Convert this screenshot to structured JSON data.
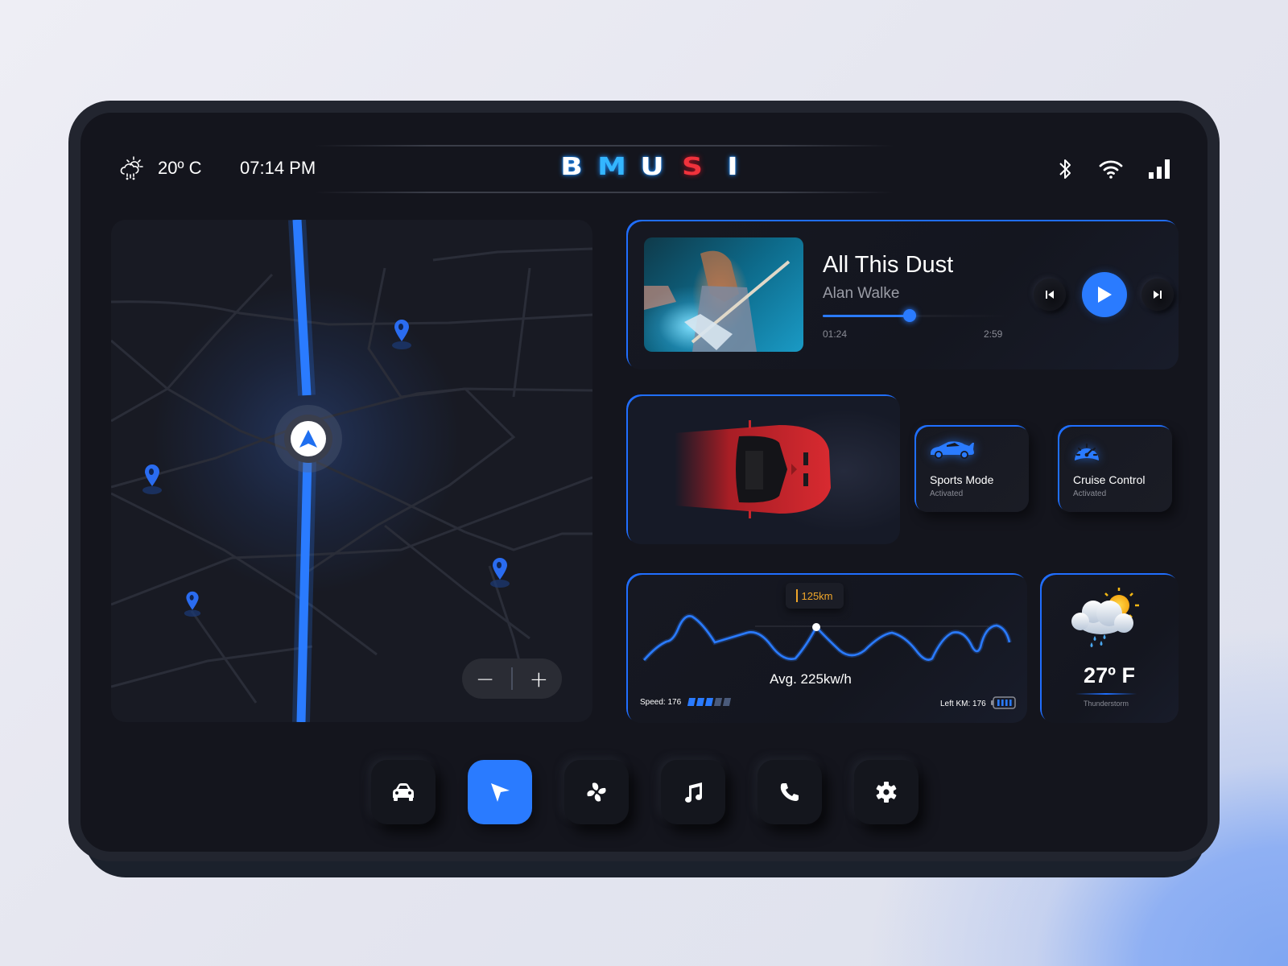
{
  "status_bar": {
    "weather_icon": "cloud-rain-sun-icon",
    "temperature": "20º C",
    "time": "07:14 PM",
    "logo_letters": [
      "B",
      "M",
      "U",
      "S",
      "I"
    ],
    "icons": [
      "bluetooth-icon",
      "wifi-icon",
      "signal-icon"
    ]
  },
  "map": {
    "zoom_out_label": "−",
    "zoom_in_label": "+",
    "pins": 4,
    "route_color": "#2a7bff"
  },
  "music": {
    "title": "All This Dust",
    "artist": "Alan Walke",
    "current_time": "01:24",
    "total_time": "2:59",
    "progress": 0.47,
    "controls": [
      "previous-icon",
      "play-icon",
      "next-icon"
    ]
  },
  "modes": [
    {
      "title": "Sports Mode",
      "status": "Activated",
      "icon": "sports-car-icon"
    },
    {
      "title": "Cruise Control",
      "status": "Activated",
      "icon": "speedometer-icon"
    }
  ],
  "energy": {
    "tooltip": "125km",
    "average": "Avg. 225kw/h",
    "speed_label": "Speed: 176",
    "speed_level": 3,
    "speed_max": 5,
    "left_km_label": "Left KM: 176",
    "battery_level": 1.0
  },
  "weather": {
    "temperature": "27º F",
    "condition": "Thunderstorm",
    "icon": "cloud-sun-rain-icon"
  },
  "bottom_nav": [
    {
      "name": "car",
      "icon": "car-icon",
      "active": false
    },
    {
      "name": "navigation",
      "icon": "navigation-arrow-icon",
      "active": true
    },
    {
      "name": "climate",
      "icon": "fan-icon",
      "active": false
    },
    {
      "name": "music",
      "icon": "music-note-icon",
      "active": false
    },
    {
      "name": "phone",
      "icon": "phone-icon",
      "active": false
    },
    {
      "name": "settings",
      "icon": "gear-icon",
      "active": false
    }
  ],
  "colors": {
    "accent": "#2a7bff",
    "tooltip": "#f0a62a",
    "logo_red": "#f0323c",
    "logo_blue": "#34b6ff"
  }
}
